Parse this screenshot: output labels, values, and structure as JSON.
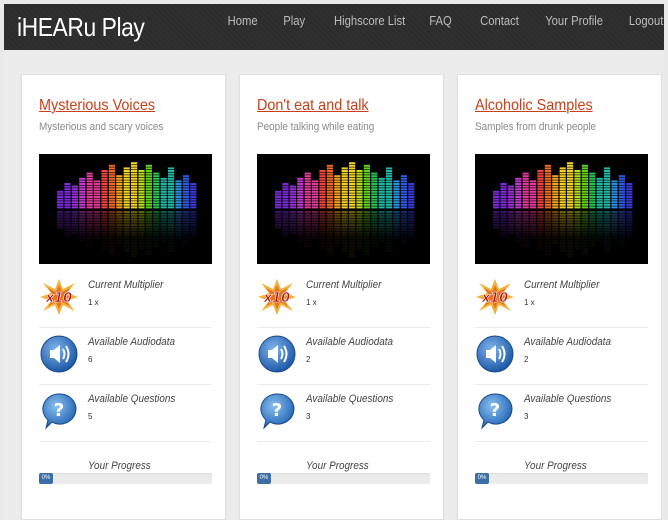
{
  "app": {
    "title": "iHEARu Play"
  },
  "nav": {
    "items": [
      {
        "label": "Home"
      },
      {
        "label": "Play"
      },
      {
        "label": "Highscore List"
      },
      {
        "label": "FAQ"
      },
      {
        "label": "Contact"
      },
      {
        "label": "Your Profile"
      },
      {
        "label": "Logout"
      }
    ]
  },
  "labels": {
    "multiplier": "Current Multiplier",
    "audiodata": "Available Audiodata",
    "questions": "Available Questions",
    "progress": "Your Progress"
  },
  "cards": [
    {
      "title": "Mysterious Voices",
      "subtitle": "Mysterious and scary voices",
      "multiplier": "1 x",
      "audiodata": "6",
      "questions": "5",
      "progress": "0%",
      "progress_value": 0
    },
    {
      "title": "Don't eat and talk",
      "subtitle": "People talking while eating",
      "multiplier": "1 x",
      "audiodata": "2",
      "questions": "3",
      "progress": "0%",
      "progress_value": 0
    },
    {
      "title": "Alcoholic Samples",
      "subtitle": "Samples from drunk people",
      "multiplier": "1 x",
      "audiodata": "2",
      "questions": "3",
      "progress": "0%",
      "progress_value": 0
    }
  ],
  "icons": {
    "multiplier": "multiplier-x10-icon",
    "audiodata": "speaker-icon",
    "questions": "question-bubble-icon"
  },
  "colors": {
    "link": "#c9411b",
    "progress": "#3a6ea5",
    "navbar": "#2e2e2e"
  }
}
